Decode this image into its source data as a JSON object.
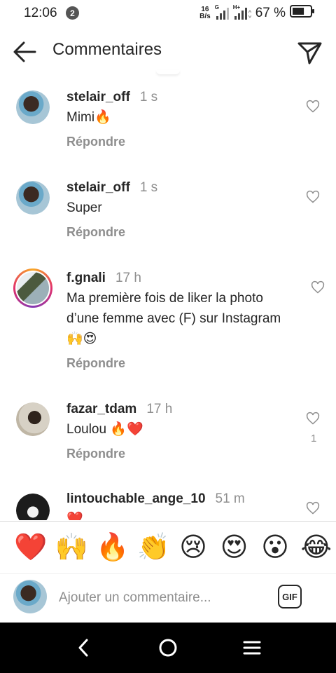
{
  "status_bar": {
    "time": "12:06",
    "notification_count": "2",
    "net_speed_value": "16",
    "net_speed_unit": "B/s",
    "network_g": "G",
    "network_h": "H+",
    "battery_percent": "67 %",
    "battery_level": 0.67
  },
  "app_bar": {
    "title": "Commentaires",
    "back_icon": "arrow-left-icon",
    "send_icon": "paper-plane-icon"
  },
  "comments": [
    {
      "username": "stelair_off",
      "time": "1 s",
      "text": "Mimi🔥",
      "reply_label": "Répondre",
      "likes": ""
    },
    {
      "username": "stelair_off",
      "time": "1 s",
      "text": "Super",
      "reply_label": "Répondre",
      "likes": ""
    },
    {
      "username": "f.gnali",
      "time": "17 h",
      "text": "Ma première fois de liker la photo d’une  femme avec (F) sur Instagram 🙌😍",
      "reply_label": "Répondre",
      "likes": ""
    },
    {
      "username": "fazar_tdam",
      "time": "17 h",
      "text": "Loulou 🔥❤️",
      "reply_label": "Répondre",
      "likes": "1"
    },
    {
      "username": "lintouchable_ange_10",
      "time": "51 m",
      "text": "❤️",
      "reply_label": "",
      "likes": ""
    }
  ],
  "emoji_bar": [
    "❤️",
    "🙌",
    "🔥",
    "👏",
    "😢",
    "😍",
    "😮",
    "😂"
  ],
  "input_bar": {
    "placeholder": "Ajouter un commentaire...",
    "value": "",
    "gif_label": "GIF"
  },
  "nav_bar": {
    "back_icon": "nav-back-icon",
    "home_icon": "nav-home-icon",
    "recents_icon": "nav-menu-icon"
  },
  "colors": {
    "text": "#262626",
    "secondary_text": "#8e8e8e",
    "nav_background": "#000000"
  }
}
